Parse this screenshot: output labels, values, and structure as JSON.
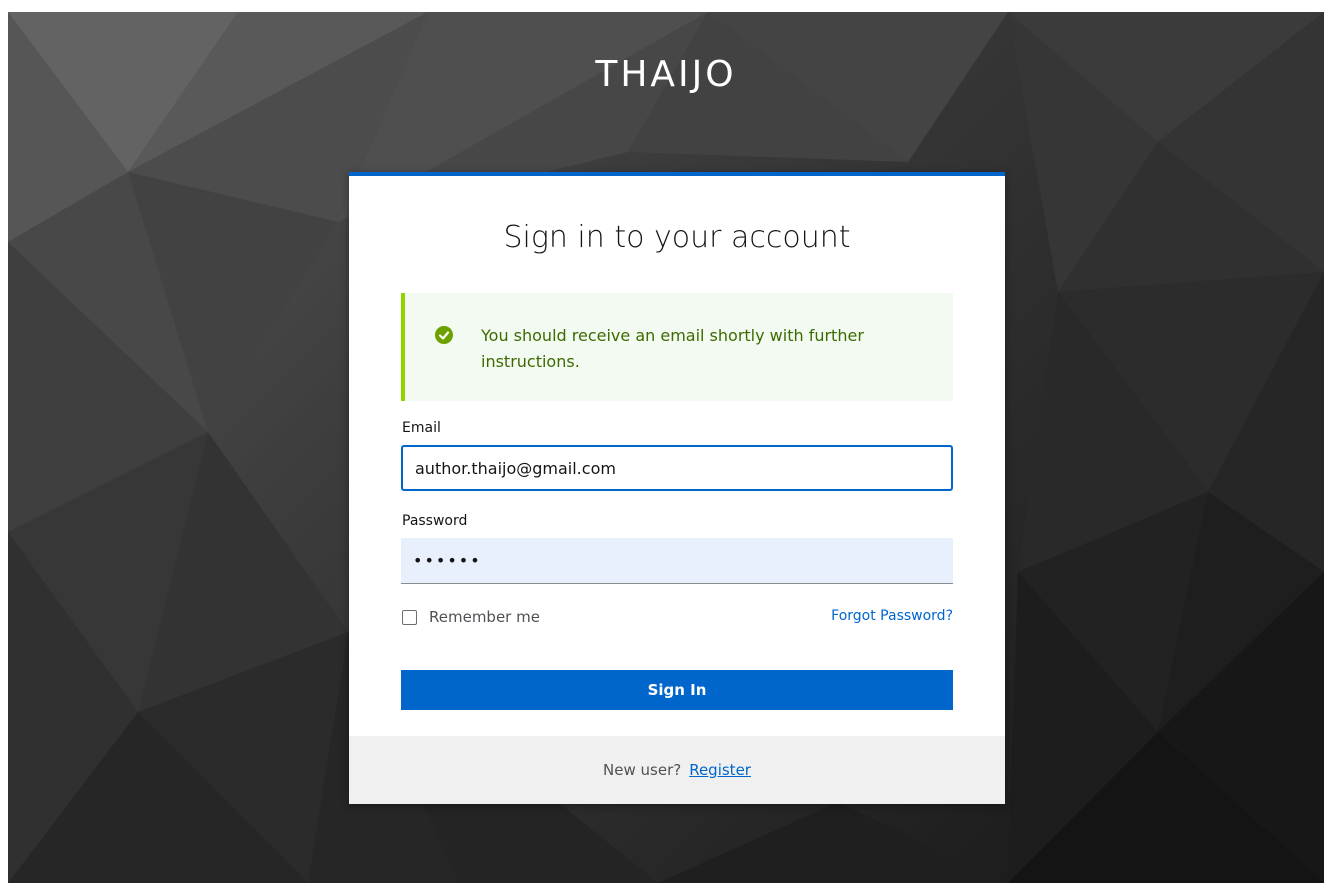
{
  "brand": {
    "name": "THAIJO"
  },
  "login": {
    "title": "Sign in to your account",
    "alert_message": "You should receive an email shortly with further instructions.",
    "email_label": "Email",
    "email_value": "author.thaijo@gmail.com",
    "password_label": "Password",
    "password_value": "••••••",
    "remember_label": "Remember me",
    "remember_checked": false,
    "forgot_label": "Forgot Password?",
    "signin_label": "Sign In"
  },
  "footer": {
    "new_user_text": "New user?",
    "register_label": "Register"
  },
  "colors": {
    "accent": "#0066cc",
    "success_bg": "#f3faf2",
    "success_border": "#92d400",
    "success_text": "#3c6b00",
    "autofill_bg": "#e8f0fe"
  },
  "icons": {
    "alert": "check-circle-icon"
  }
}
